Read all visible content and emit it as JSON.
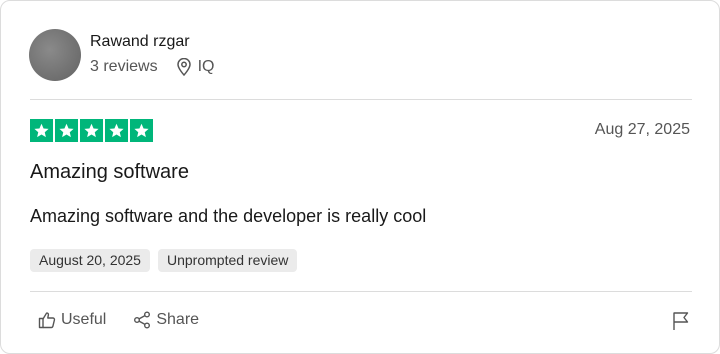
{
  "reviewer": {
    "name": "Rawand rzgar",
    "reviews_count": "3 reviews",
    "country": "IQ",
    "avatar_icon": "avatar"
  },
  "review": {
    "rating": 5,
    "rating_max": 5,
    "star_color": "#00b67a",
    "date": "Aug 27, 2025",
    "title": "Amazing software",
    "text": "Amazing software and the developer is really cool",
    "tags": [
      "August 20, 2025",
      "Unprompted review"
    ]
  },
  "actions": {
    "useful_label": "Useful",
    "share_label": "Share",
    "icons": {
      "useful": "thumbs-up-icon",
      "share": "share-icon",
      "report": "flag-icon",
      "location": "location-pin-icon"
    }
  }
}
